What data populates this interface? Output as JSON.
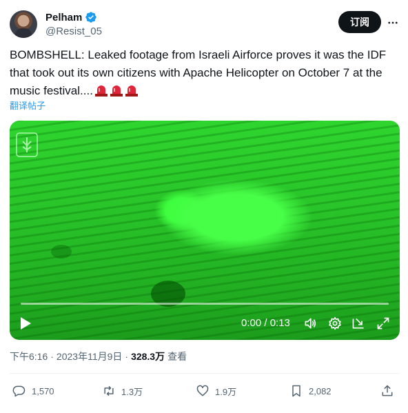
{
  "author": {
    "display_name": "Pelham",
    "handle": "@Resist_05",
    "verified": true
  },
  "subscribe_label": "订阅",
  "tweet": {
    "text": "BOMBSHELL: Leaked footage from Israeli Airforce proves it was the IDF that took out its own citizens with Apache Helicopter on October 7 at the music festival....",
    "emoji": [
      "siren-emoji",
      "siren-emoji",
      "siren-emoji"
    ],
    "translate_label": "翻译帖子"
  },
  "video": {
    "time": "0:00 / 0:13",
    "progress": 0
  },
  "meta": {
    "time": "下午6:16",
    "separator": "·",
    "date": "2023年11月9日",
    "separator2": "·",
    "views": "328.3万",
    "views_label": "查看"
  },
  "actions": {
    "replies": "1,570",
    "retweets": "1.3万",
    "likes": "1.9万",
    "bookmarks": "2,082"
  },
  "colors": {
    "accent": "#1d9bf0",
    "text": "#0f1419",
    "secondary": "#536471",
    "video_green": "#2fd52f"
  }
}
